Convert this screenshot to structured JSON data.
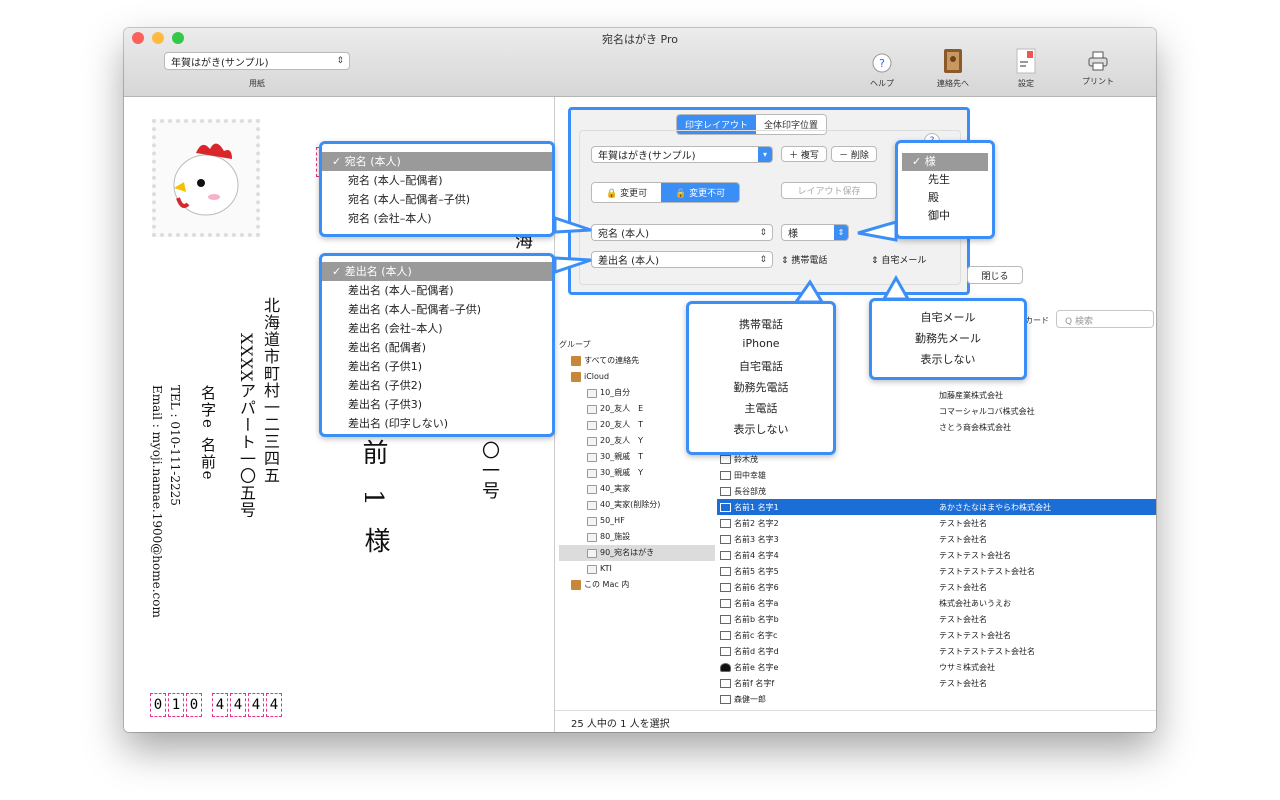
{
  "window": {
    "title": "宛名はがき Pro"
  },
  "toolbar": {
    "paper_select": "年賀はがき(サンプル)",
    "paper_label": "用紙",
    "help_label": "ヘルプ",
    "contacts_label": "連絡先へ",
    "settings_label": "設定",
    "print_label": "プリント"
  },
  "postcard": {
    "address_line1": "北海道市町村一二三四五",
    "address_line2": "XXXXアパート一〇五号",
    "sender_name": "名字e 名前e",
    "tel": "TEL : 010-111-2225",
    "email": "Email : myoji.namae.1900@home.com",
    "recipient_name_line": "前 1",
    "recipient_honorific": "様",
    "recipient_addr_top": "海",
    "recipient_addr_bottom": "一〇一号",
    "zip_digits": [
      "0",
      "1",
      "0",
      "4",
      "4",
      "4",
      "4"
    ]
  },
  "panel": {
    "tab_print_layout": "印字レイアウト",
    "tab_all_position": "全体印字位置",
    "layout_select": "年賀はがき(サンプル)",
    "copy_btn": "＋ 複写",
    "delete_btn": "－ 削除",
    "editable_btn": "🔒 変更可",
    "locked_btn": "🔒 変更不可",
    "save_layout_btn": "レイアウト保存",
    "recipient_select": "宛名 (本人)",
    "honorific_select": "様",
    "sender_select": "差出名 (本人)",
    "phone_select": "携帯電話",
    "mail_select": "自宅メール",
    "close_btn": "閉じる",
    "help_q": "?"
  },
  "callouts": {
    "recipient_options": [
      "宛名 (本人)",
      "宛名 (本人–配偶者)",
      "宛名 (本人–配偶者–子供)",
      "宛名 (会社–本人)"
    ],
    "sender_options": [
      "差出名 (本人)",
      "差出名 (本人–配偶者)",
      "差出名 (本人–配偶者–子供)",
      "差出名 (会社–本人)",
      "差出名 (配偶者)",
      "差出名 (子供1)",
      "差出名 (子供2)",
      "差出名 (子供3)",
      "差出名 (印字しない)"
    ],
    "honorific_options": [
      "様",
      "先生",
      "殿",
      "御中"
    ],
    "phone_options": [
      "携帯電話",
      "iPhone",
      "自宅電話",
      "勤務先電話",
      "主電話",
      "表示しない"
    ],
    "mail_options": [
      "自宅メール",
      "勤務先メール",
      "表示しない"
    ],
    "check": "✓"
  },
  "contacts": {
    "card_label": "カード",
    "search_placeholder": "Q 検索",
    "group_header": "グループ",
    "groups": [
      {
        "label": "すべての連絡先",
        "level": 0,
        "kind": "book"
      },
      {
        "label": "iCloud",
        "level": 0,
        "kind": "book"
      },
      {
        "label": "10_自分",
        "level": 1,
        "kind": "group"
      },
      {
        "label": "20_友人　E",
        "level": 1,
        "kind": "group"
      },
      {
        "label": "20_友人　T",
        "level": 1,
        "kind": "group"
      },
      {
        "label": "20_友人　Y",
        "level": 1,
        "kind": "group"
      },
      {
        "label": "30_親戚　T",
        "level": 1,
        "kind": "group"
      },
      {
        "label": "30_親戚　Y",
        "level": 1,
        "kind": "group"
      },
      {
        "label": "40_実家",
        "level": 1,
        "kind": "group"
      },
      {
        "label": "40_実家(削除分)",
        "level": 1,
        "kind": "group"
      },
      {
        "label": "50_HF",
        "level": 1,
        "kind": "group"
      },
      {
        "label": "80_施設",
        "level": 1,
        "kind": "group"
      },
      {
        "label": "90_宛名はがき",
        "level": 1,
        "kind": "group"
      },
      {
        "label": "KTI",
        "level": 1,
        "kind": "group"
      },
      {
        "label": "この Mac 内",
        "level": 0,
        "kind": "book"
      }
    ],
    "rows": [
      {
        "name": "",
        "company": "加藤産業株式会社"
      },
      {
        "name": "",
        "company": "コマーシャルコバ株式会社"
      },
      {
        "name": "",
        "company": "さとう商会株式会社"
      },
      {
        "name": "",
        "company": ""
      },
      {
        "name": "鈴木茂",
        "company": ""
      },
      {
        "name": "田中幸雄",
        "company": ""
      },
      {
        "name": "長谷部茂",
        "company": ""
      },
      {
        "name": "名前1 名字1",
        "company": "あかさたなはまやらわ株式会社",
        "selected": true
      },
      {
        "name": "名前2 名字2",
        "company": "テスト会社名"
      },
      {
        "name": "名前3 名字3",
        "company": "テスト会社名"
      },
      {
        "name": "名前4 名字4",
        "company": "テストテスト会社名"
      },
      {
        "name": "名前5 名字5",
        "company": "テストテストテスト会社名"
      },
      {
        "name": "名前6 名字6",
        "company": "テスト会社名"
      },
      {
        "name": "名前a 名字a",
        "company": "株式会社あいうえお"
      },
      {
        "name": "名前b 名字b",
        "company": "テスト会社名"
      },
      {
        "name": "名前c 名字c",
        "company": "テストテスト会社名"
      },
      {
        "name": "名前d 名字d",
        "company": "テストテストテスト会社名"
      },
      {
        "name": "名前e 名字e",
        "company": "ウサミ株式会社",
        "person": true
      },
      {
        "name": "名前f 名字f",
        "company": "テスト会社名"
      },
      {
        "name": "森健一郎",
        "company": ""
      }
    ],
    "status": "25 人中の 1 人を選択"
  }
}
